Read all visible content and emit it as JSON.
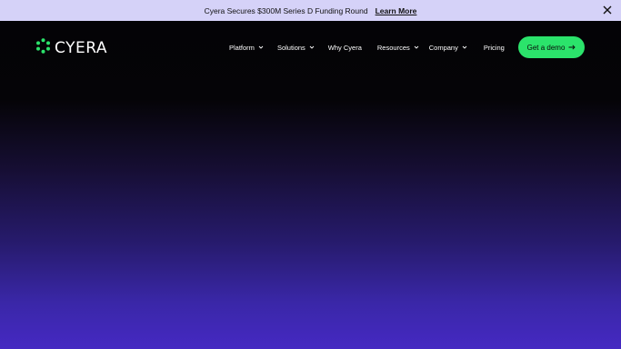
{
  "announcement": {
    "text": "Cyera Secures $300M Series D Funding Round",
    "link_label": "Learn More"
  },
  "brand": {
    "name": "CYERA",
    "accent": "#2be36b"
  },
  "nav": {
    "items": [
      {
        "label": "Platform",
        "has_dropdown": true
      },
      {
        "label": "Solutions",
        "has_dropdown": true
      },
      {
        "label": "Why Cyera",
        "has_dropdown": false
      },
      {
        "label": "Resources",
        "has_dropdown": true
      },
      {
        "label": "Company",
        "has_dropdown": true
      },
      {
        "label": "Pricing",
        "has_dropdown": false
      }
    ],
    "cta_label": "Get a demo",
    "cta_icon": "arrow-right-icon"
  },
  "colors": {
    "announce_bg": "#d5d2f8",
    "hero_top": "#040306",
    "hero_bottom": "#4529c2"
  }
}
